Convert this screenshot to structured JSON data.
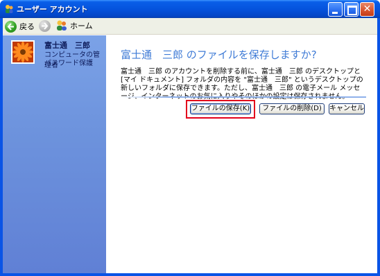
{
  "window": {
    "title": "ユーザー アカウント",
    "icon": "users-app-icon"
  },
  "toolbar": {
    "back_label": "戻る",
    "home_label": "ホーム"
  },
  "user": {
    "name": "富士通　三郎",
    "line1": "コンピュータの管理者",
    "line2": "パスワード保護"
  },
  "main": {
    "title": "富士通　三郎 のファイルを保存しますか?",
    "description": "富士通　三郎 のアカウントを削除する前に、富士通　三郎 のデスクトップと [マイ ドキュメント] フォルダの内容を \"富士通　三郎\" というデスクトップの新しいフォルダに保存できます。ただし、富士通　三郎 の電子メール メッセージ、インターネットのお気に入りやそのほかの設定は保存されません。"
  },
  "buttons": {
    "save_label": "ファイルの保存(K)",
    "delete_label": "ファイルの削除(D)",
    "cancel_label": "キャンセル"
  },
  "colors": {
    "title_blue": "#3F7BD6",
    "highlight_red": "#E3001B"
  }
}
